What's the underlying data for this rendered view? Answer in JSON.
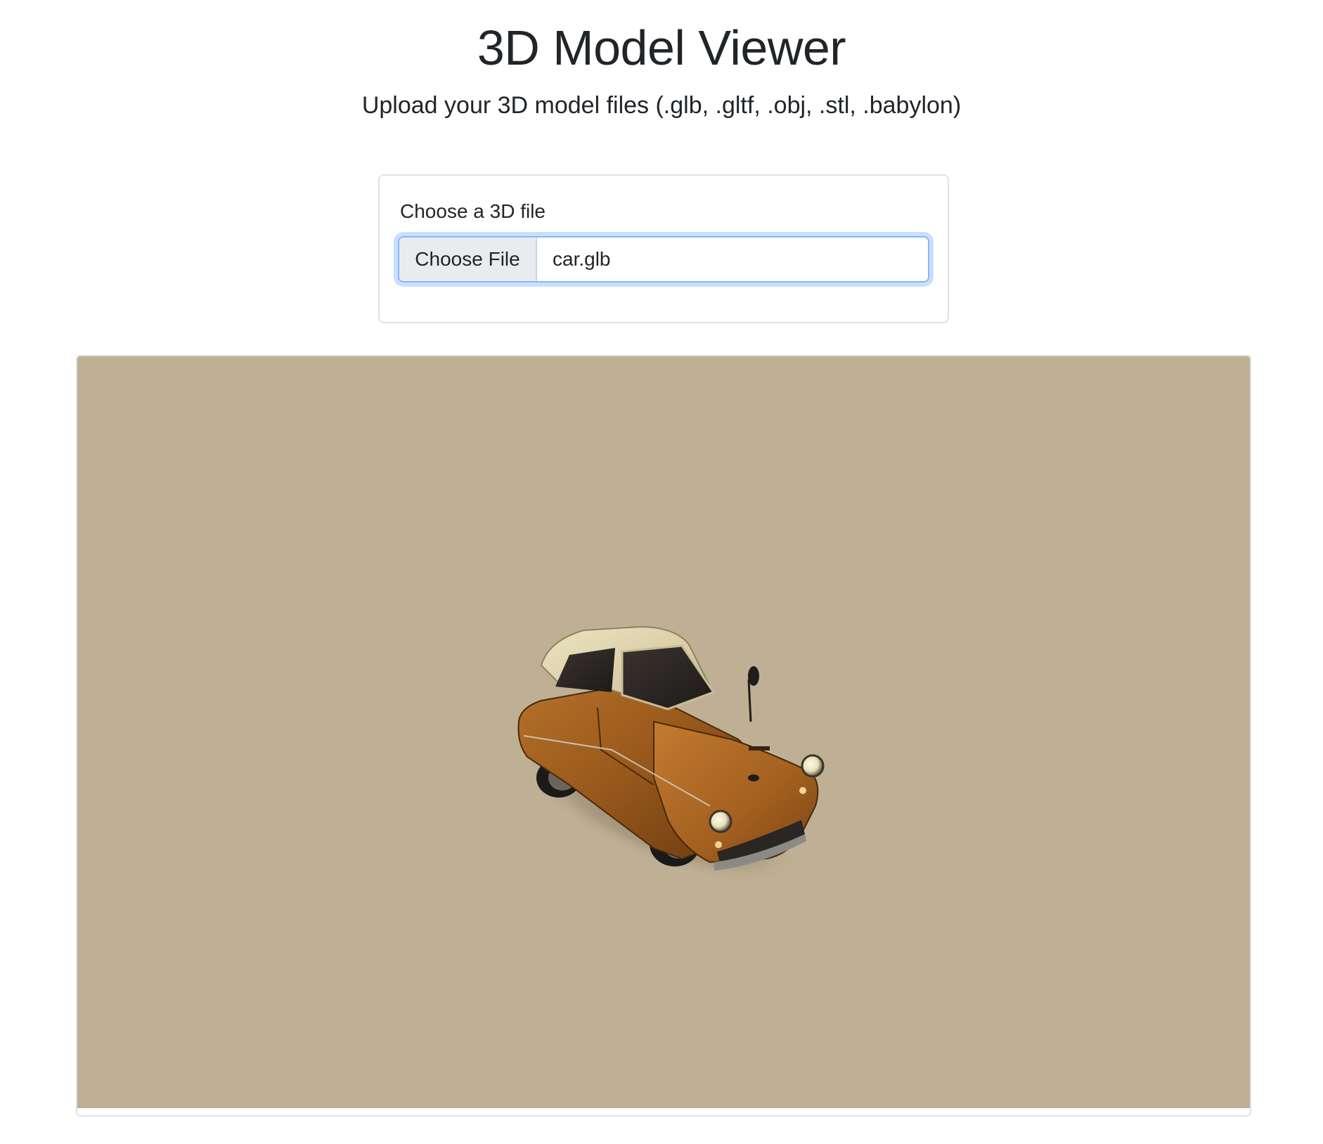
{
  "header": {
    "title": "3D Model Viewer",
    "subtitle": "Upload your 3D model files (.glb, .gltf, .obj, .stl, .babylon)"
  },
  "upload": {
    "label": "Choose a 3D file",
    "button_label": "Choose File",
    "file_name": "car.glb"
  },
  "viewer": {
    "background_color": "#bfb095",
    "model": "car-model-icon"
  }
}
